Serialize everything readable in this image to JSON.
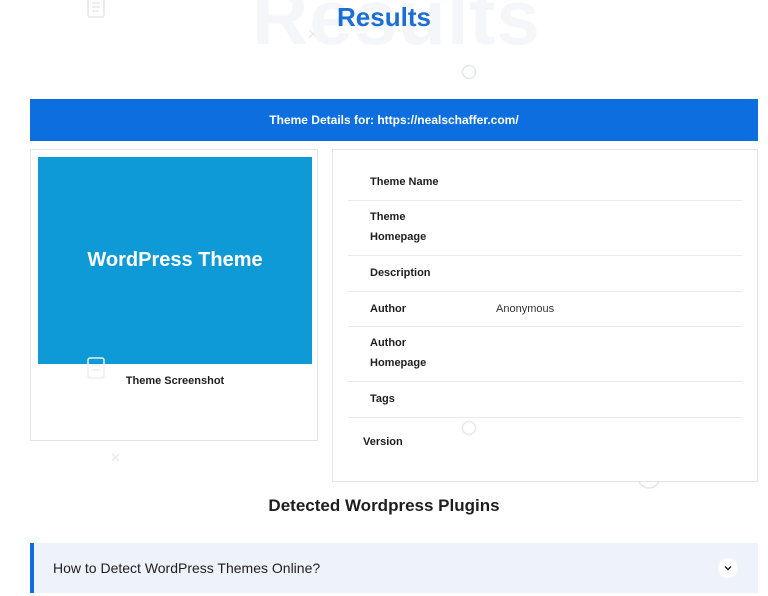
{
  "header": {
    "ghost_text": "Results",
    "title": "Results"
  },
  "details_bar": {
    "label": "Theme Details for: https://nealschaffer.com/"
  },
  "screenshot_card": {
    "preview_text": "WordPress Theme",
    "caption": "Theme Screenshot"
  },
  "details": {
    "rows": [
      {
        "label": "Theme Name",
        "value": ""
      },
      {
        "label": "Theme Homepage",
        "value": ""
      },
      {
        "label": "Description",
        "value": ""
      },
      {
        "label": "Author",
        "value": "Anonymous"
      },
      {
        "label": "Author Homepage",
        "value": ""
      },
      {
        "label": "Tags",
        "value": ""
      },
      {
        "label": "Version",
        "value": ""
      }
    ]
  },
  "plugins": {
    "title": "Detected Wordpress Plugins"
  },
  "faq": {
    "question": "How to Detect WordPress Themes Online?"
  },
  "colors": {
    "accent": "#0d6fdf",
    "title_blue": "#1a6fd6",
    "preview_bg": "#0e9ad6",
    "accordion_bg": "#eef3fb"
  }
}
